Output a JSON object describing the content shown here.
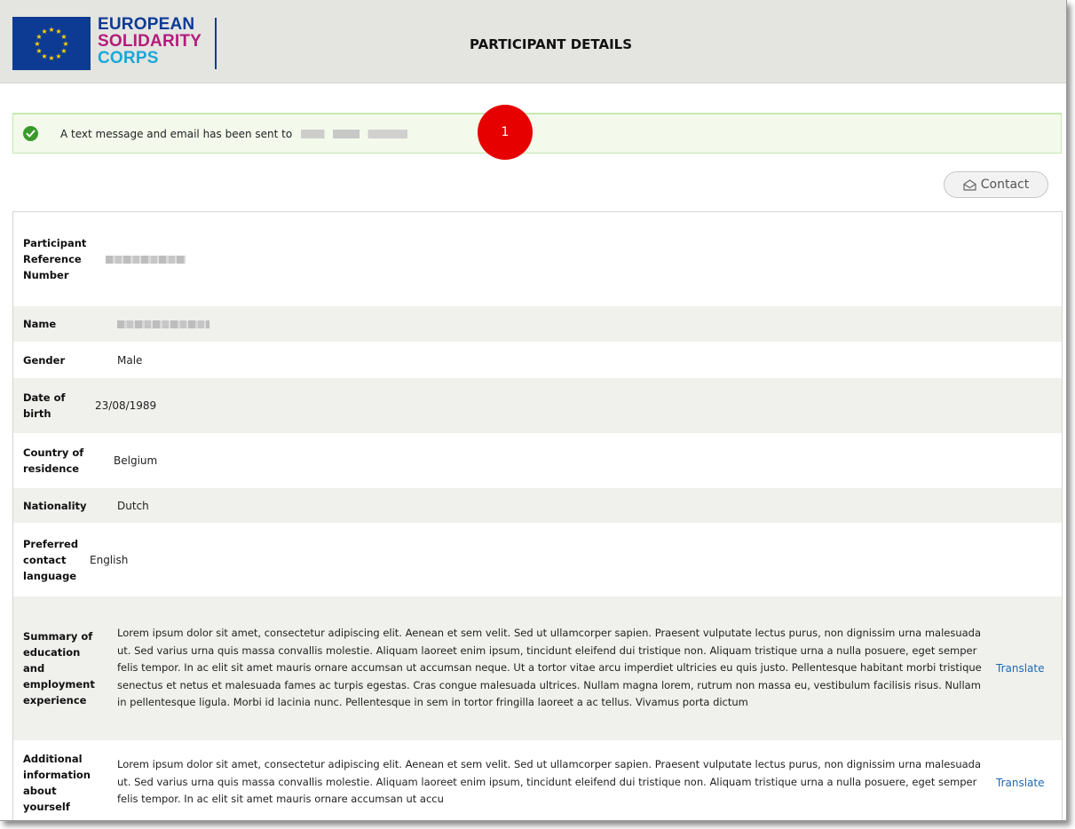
{
  "header": {
    "logo": {
      "line1": "EUROPEAN",
      "line2": "SOLIDARITY",
      "line3": "CORPS"
    },
    "title": "PARTICIPANT DETAILS"
  },
  "alert": {
    "message": "A text message and email has been sent to"
  },
  "step_badge": "1",
  "contact_button": {
    "label": "Contact"
  },
  "details": {
    "rows": [
      {
        "label": "Participant Reference Number",
        "value": ""
      },
      {
        "label": "Name",
        "value": ""
      },
      {
        "label": "Gender",
        "value": "Male"
      },
      {
        "label": "Date of birth",
        "value": "23/08/1989"
      },
      {
        "label": "Country of residence",
        "value": "Belgium"
      },
      {
        "label": "Nationality",
        "value": "Dutch"
      },
      {
        "label": "Preferred contact language",
        "value": "English"
      },
      {
        "label": "Summary of education and employment experience",
        "value": "Lorem ipsum dolor sit amet, consectetur adipiscing elit. Aenean et sem velit. Sed ut ullamcorper sapien. Praesent vulputate lectus purus, non dignissim urna malesuada ut. Sed varius urna quis massa convallis molestie. Aliquam laoreet enim ipsum, tincidunt eleifend dui tristique non. Aliquam tristique urna a nulla posuere, eget semper felis tempor. In ac elit sit amet mauris ornare accumsan ut accumsan neque. Ut a tortor vitae arcu imperdiet ultricies eu quis justo. Pellentesque habitant morbi tristique senectus et netus et malesuada fames ac turpis egestas. Cras congue malesuada ultrices. Nullam magna lorem, rutrum non massa eu, vestibulum facilisis risus. Nullam in pellentesque ligula. Morbi id lacinia nunc. Pellentesque in sem in tortor fringilla laoreet a ac tellus. Vivamus porta dictum",
        "action": "Translate"
      },
      {
        "label": "Additional information about yourself",
        "value": "Lorem ipsum dolor sit amet, consectetur adipiscing elit. Aenean et sem velit. Sed ut ullamcorper sapien. Praesent vulputate lectus purus, non dignissim urna malesuada ut. Sed varius urna quis massa convallis molestie. Aliquam laoreet enim ipsum, tincidunt eleifend dui tristique non. Aliquam tristique urna a nulla posuere, eget semper felis tempor. In ac elit sit amet mauris ornare accumsan ut accu",
        "action": "Translate"
      }
    ]
  },
  "colors": {
    "header_bg": "#e4e4e1",
    "eu_blue": "#0d3b93",
    "logo_magenta": "#b51b7a",
    "logo_cyan": "#1aa8d8",
    "alert_bg": "#f3faec",
    "alert_border": "#c5e8ad",
    "success_green": "#3a9a2c",
    "badge_red": "#e60000",
    "link_blue": "#1d69b4",
    "row_alt_bg": "#f0f0ec"
  },
  "icons": {
    "alert": "check-circle-icon",
    "contact": "envelope-open-icon"
  }
}
